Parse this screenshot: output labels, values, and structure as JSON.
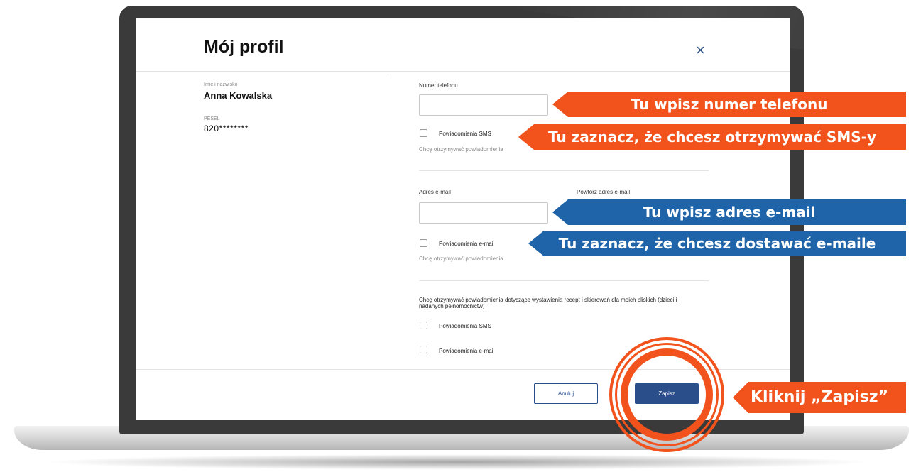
{
  "modal": {
    "title": "Mój profil",
    "close_icon": "×"
  },
  "profile": {
    "name_label": "Imię i nazwisko",
    "name_value": "Anna Kowalska",
    "pesel_label": "PESEL",
    "pesel_value": "820********"
  },
  "phone_section": {
    "phone_label": "Numer telefonu",
    "phone_value": "",
    "sms_checkbox_label": "Powiadomienia SMS",
    "sms_checked": false,
    "sms_hint_prefix": "Chcę otrzymywać powiadomienia"
  },
  "email_section": {
    "email_label": "Adres e-mail",
    "email_value": "",
    "repeat_email_label": "Powtórz adres e-mail",
    "email_checkbox_label": "Powiadomienia e-mail",
    "email_checked": false,
    "email_hint_prefix": "Chcę otrzymywać powiadomienia"
  },
  "relatives_section": {
    "description": "Chcę otrzymywać powiadomienia dotyczące wystawienia recept i skierowań dla moich bliskich (dzieci i nadanych pełnomocnictw)",
    "sms_checkbox_label": "Powiadomienia SMS",
    "email_checkbox_label": "Powiadomienia e-mail"
  },
  "footer": {
    "cancel_label": "Anuluj",
    "save_label": "Zapisz"
  },
  "callouts": {
    "phone": "Tu wpisz numer telefonu",
    "sms": "Tu zaznacz, że chcesz otrzymywać SMS-y",
    "email": "Tu wpisz adres e-mail",
    "email_notify": "Tu zaznacz, że chcesz dostawać e-maile",
    "save": "Kliknij „Zapisz”"
  },
  "colors": {
    "accent_orange": "#f2531c",
    "accent_blue": "#1f64a8",
    "primary_button": "#2a4e8a"
  }
}
